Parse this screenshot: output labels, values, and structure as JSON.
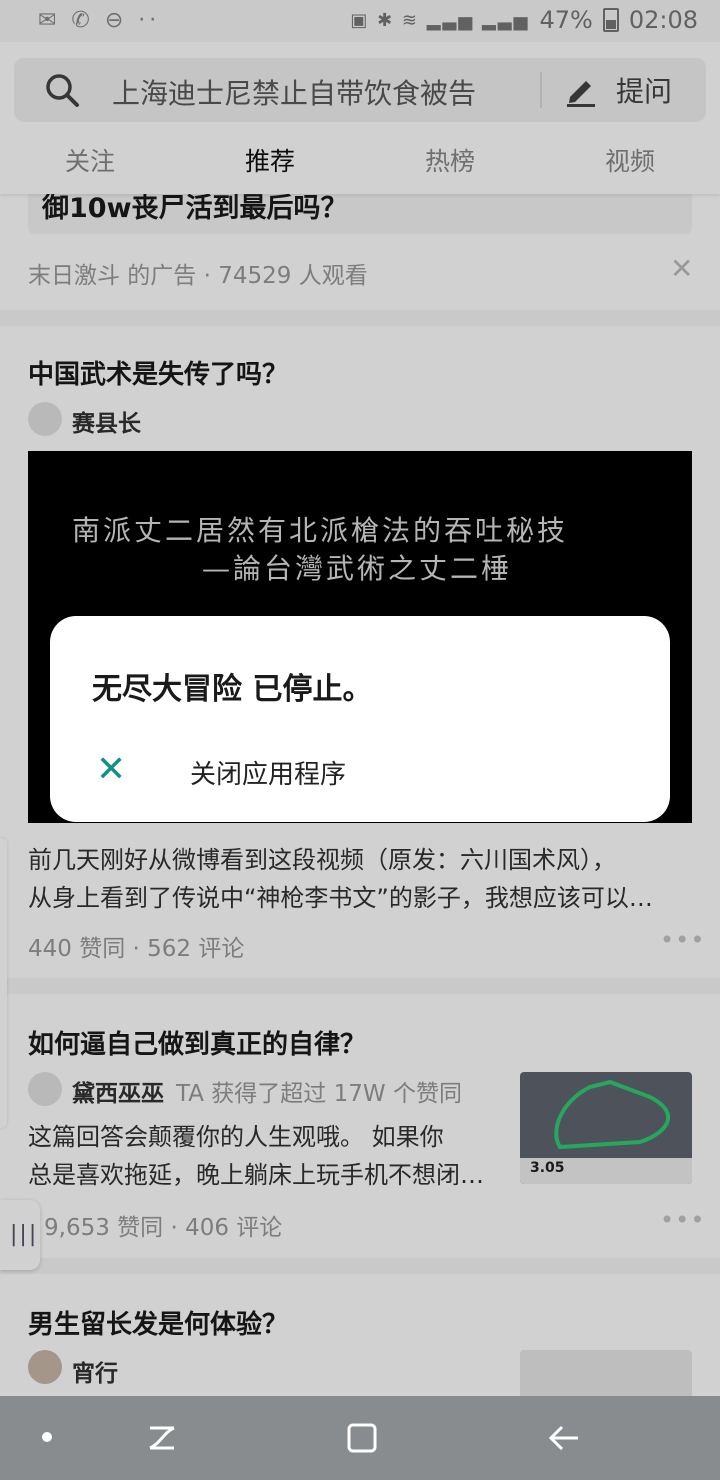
{
  "status_bar": {
    "left_icons": "✉ ✆ ⊖ ··",
    "battery": "47%",
    "time": "02:08"
  },
  "search": {
    "text": "上海迪士尼禁止自带饮食被告",
    "ask_label": "提问"
  },
  "tabs": [
    {
      "label": "关注"
    },
    {
      "label": "推荐"
    },
    {
      "label": "热榜"
    },
    {
      "label": "视频"
    }
  ],
  "ad": {
    "title_partial": "御10w丧尸活到最后吗？",
    "meta": "末日激斗 的广告 · 74529 人观看"
  },
  "post1": {
    "title": "中国武术是失传了吗？",
    "author": "赛县长",
    "video_line1": "南派丈二居然有北派槍法的吞吐秘技",
    "video_line2": "—論台灣武術之丈二棰",
    "excerpt_line1": "前几天刚好从微博看到这段视频（原发：六川国术风），",
    "excerpt_line2": "从身上看到了传说中“神枪李书文”的影子，我想应该可以…",
    "stats": "440 赞同 · 562 评论"
  },
  "post2": {
    "title": "如何逼自己做到真正的自律？",
    "author": "黛西巫巫",
    "author_note": "TA 获得了超过 17W 个赞同",
    "excerpt_line1": "这篇回答会颠覆你的人生观哦。 如果你",
    "excerpt_line2": "总是喜欢拖延，晚上躺床上玩手机不想闭…",
    "stats": "9,653 赞同 · 406 评论",
    "thumb_label": "3.05"
  },
  "post3": {
    "title": "男生留长发是何体验？",
    "author": "宵行"
  },
  "dialog": {
    "title": "无尽大冒险 已停止。",
    "close_label": "关闭应用程序"
  },
  "colors": {
    "accent": "#119384",
    "navbar": "#898c8e"
  }
}
